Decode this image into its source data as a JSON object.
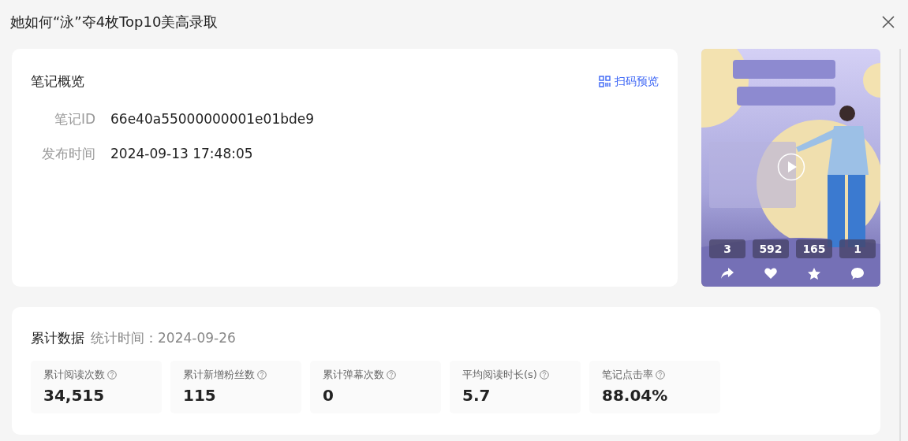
{
  "title": "她如何“泳”夺4枚Top10美高录取",
  "overview": {
    "heading": "笔记概览",
    "scan_link": "扫码预览",
    "fields": [
      {
        "label": "笔记ID",
        "value": "66e40a55000000001e01bde9"
      },
      {
        "label": "发布时间",
        "value": "2024-09-13 17:48:05"
      }
    ]
  },
  "cover": {
    "kind": "picture",
    "stats": [
      {
        "kind": "share",
        "count": "3"
      },
      {
        "kind": "like",
        "count": "592"
      },
      {
        "kind": "collect",
        "count": "165"
      },
      {
        "kind": "comment",
        "count": "1"
      }
    ]
  },
  "cumulative": {
    "heading": "累计数据",
    "stat_time": "统计时间：2024-09-26",
    "metrics": [
      {
        "label": "累计阅读次数",
        "value": "34,515"
      },
      {
        "label": "累计新增粉丝数",
        "value": "115"
      },
      {
        "label": "累计弹幕次数",
        "value": "0"
      },
      {
        "label": "平均阅读时长(s)",
        "value": "5.7"
      },
      {
        "label": "笔记点击率",
        "value": "88.04%"
      }
    ]
  }
}
